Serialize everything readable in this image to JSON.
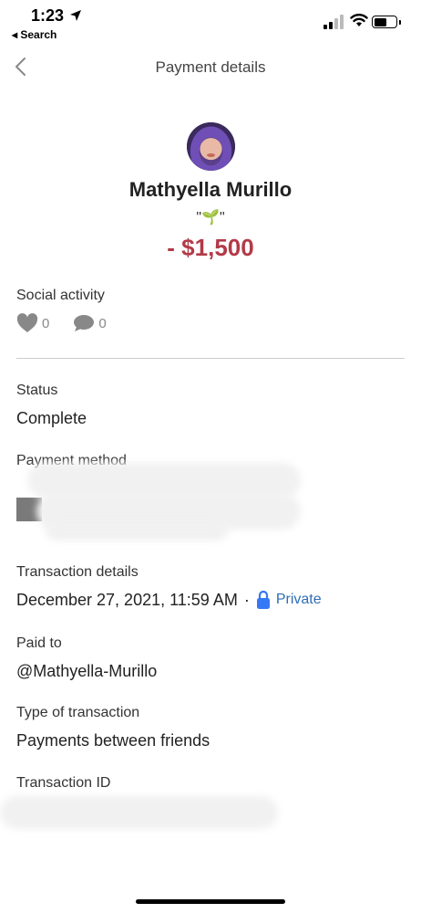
{
  "status_bar": {
    "time": "1:23",
    "back_app": "◂ Search"
  },
  "nav": {
    "title": "Payment details"
  },
  "profile": {
    "name": "Mathyella Murillo",
    "note": "\"🌱\"",
    "amount": "- $1,500"
  },
  "social": {
    "label": "Social activity",
    "likes": "0",
    "comments": "0"
  },
  "status": {
    "label": "Status",
    "value": "Complete"
  },
  "payment_method": {
    "label": "Payment method"
  },
  "transaction_details": {
    "label": "Transaction details",
    "datetime": "December 27, 2021, 11:59 AM",
    "separator": "·",
    "privacy": "Private"
  },
  "paid_to": {
    "label": "Paid to",
    "value": "@Mathyella-Murillo"
  },
  "transaction_type": {
    "label": "Type of transaction",
    "value": "Payments between friends"
  },
  "transaction_id": {
    "label": "Transaction ID"
  },
  "colors": {
    "amount": "#b23a48",
    "private_link": "#2f6db5",
    "lock": "#3478f6"
  }
}
